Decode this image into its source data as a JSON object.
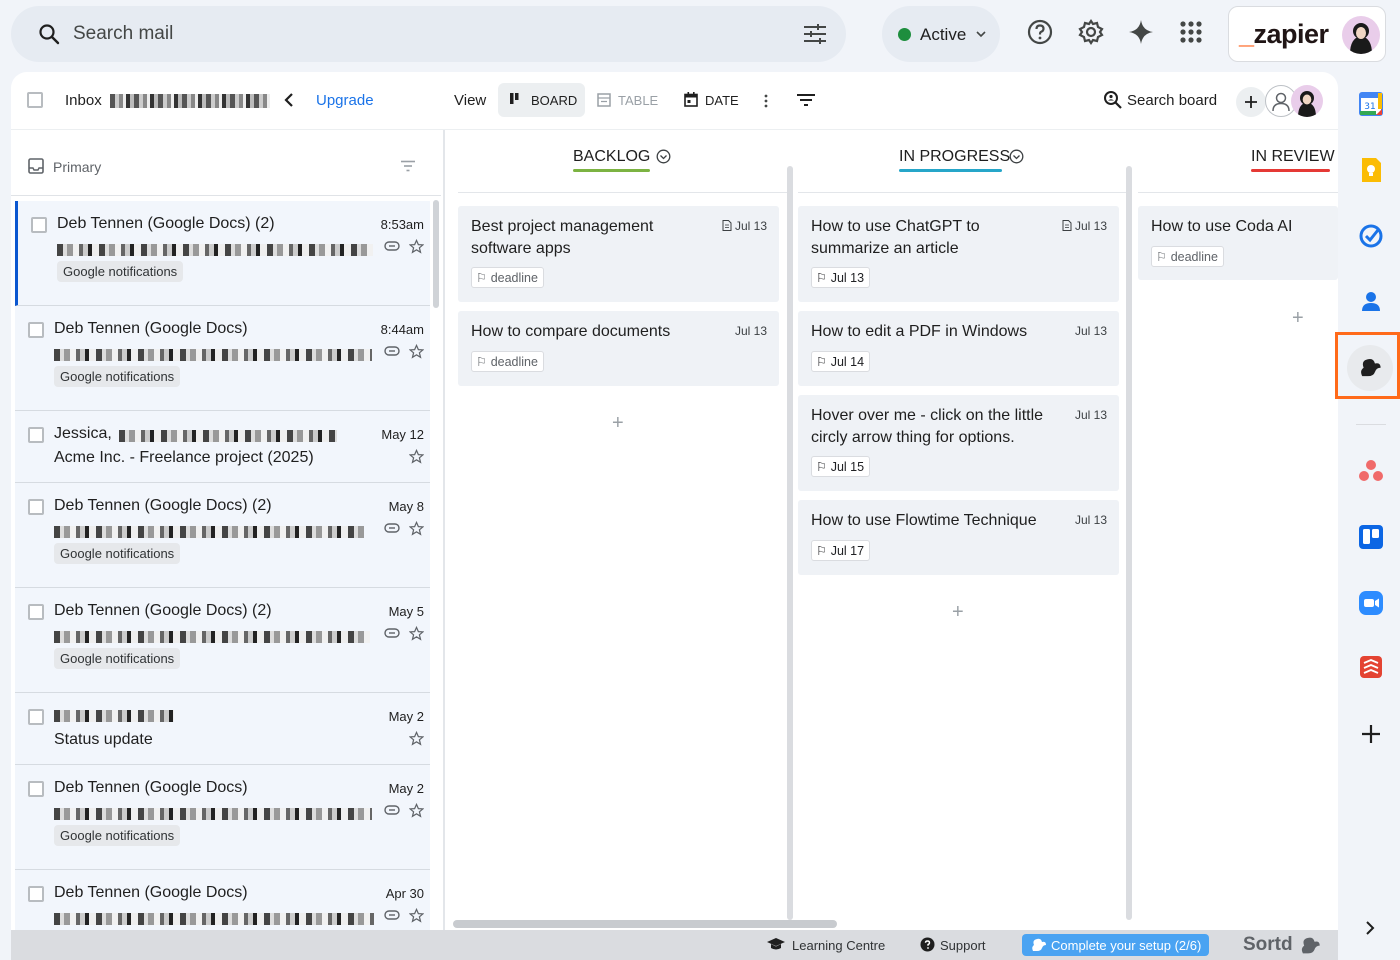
{
  "search": {
    "placeholder": "Search mail"
  },
  "status": {
    "label": "Active"
  },
  "brand": {
    "logo_text": "zapier"
  },
  "toolbar": {
    "inbox_label": "Inbox",
    "upgrade_label": "Upgrade",
    "view_label": "View",
    "board_label": "BOARD",
    "table_label": "TABLE",
    "date_label": "DATE",
    "search_board_label": "Search board"
  },
  "list_header": {
    "label": "Primary"
  },
  "emails": [
    {
      "from": "Deb Tennen (Google Docs) (2)",
      "date": "8:53am",
      "tag": "Google notifications"
    },
    {
      "from": "Deb Tennen (Google Docs)",
      "date": "8:44am",
      "tag": "Google notifications"
    },
    {
      "from": "Jessica,",
      "subject": "Acme Inc. - Freelance project (2025)",
      "date": "May 12"
    },
    {
      "from": "Deb Tennen (Google Docs) (2)",
      "date": "May 8",
      "tag": "Google notifications"
    },
    {
      "from": "Deb Tennen (Google Docs) (2)",
      "date": "May 5",
      "tag": "Google notifications"
    },
    {
      "subject": "Status update",
      "date": "May 2"
    },
    {
      "from": "Deb Tennen (Google Docs)",
      "date": "May 2",
      "tag": "Google notifications"
    },
    {
      "from": "Deb Tennen (Google Docs)",
      "date": "Apr 30"
    }
  ],
  "board": {
    "columns": [
      {
        "title": "BACKLOG",
        "color": "#7cb342",
        "cards": [
          {
            "title": "Best project management software apps",
            "date": "Jul 13",
            "chip": "deadline"
          },
          {
            "title": "How to compare documents",
            "date": "Jul 13",
            "chip": "deadline"
          }
        ]
      },
      {
        "title": "IN PROGRESS",
        "color": "#26a6c9",
        "cards": [
          {
            "title": "How to use ChatGPT to summarize an article",
            "date": "Jul 13",
            "chip": "Jul 13"
          },
          {
            "title": "How to edit a PDF in Windows",
            "date": "Jul 13",
            "chip": "Jul 14"
          },
          {
            "title": "Hover over me - click on the little circly arrow thing for options.",
            "date": "Jul 13",
            "chip": "Jul 15"
          },
          {
            "title": "How to use Flowtime Technique",
            "date": "Jul 13",
            "chip": "Jul 17"
          }
        ]
      },
      {
        "title": "IN REVIEW",
        "color": "#e53935",
        "cards": [
          {
            "title": "How to use Coda AI",
            "chip": "deadline"
          }
        ]
      }
    ]
  },
  "footer": {
    "learning_label": "Learning Centre",
    "support_label": "Support",
    "setup_label": "Complete your setup (2/6)",
    "brand_label": "Sortd"
  },
  "rail": {
    "calendar_day": "31",
    "icons": [
      "google-calendar-icon",
      "google-keep-icon",
      "google-tasks-icon",
      "google-contacts-icon",
      "sortd-icon",
      "asana-icon",
      "trello-icon",
      "zoom-icon",
      "todoist-icon",
      "add-icon"
    ]
  }
}
